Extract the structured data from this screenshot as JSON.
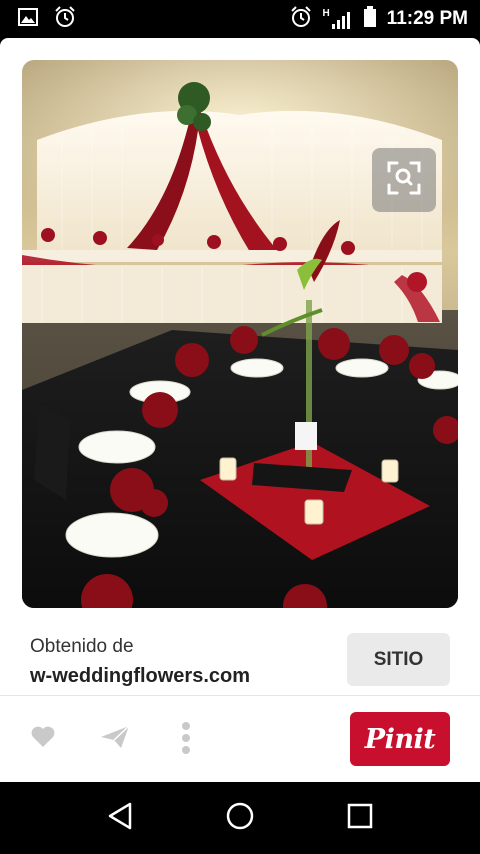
{
  "status_bar": {
    "time": "11:29 PM",
    "network_label": "H",
    "icons": [
      "gallery-icon",
      "alarm-icon",
      "alarm-icon",
      "signal-icon",
      "battery-icon"
    ]
  },
  "pin": {
    "image_alt": "Wedding reception hall with white draped head table, red swags and a black table with red napkins and a tall calla lily centerpiece",
    "visual_search_icon": "visual-search-icon"
  },
  "source": {
    "label": "Obtenido de",
    "domain": "w-weddingflowers.com",
    "visit_label": "SITIO"
  },
  "actions": {
    "like_icon": "heart-icon",
    "send_icon": "send-icon",
    "more_icon": "more-vertical-icon",
    "pin_it_label": "Pinit"
  },
  "nav_bar": {
    "icons": [
      "back-icon",
      "home-icon",
      "recents-icon"
    ]
  },
  "colors": {
    "pinterest_red": "#c8102e",
    "sitio_bg": "#eaeaea"
  }
}
